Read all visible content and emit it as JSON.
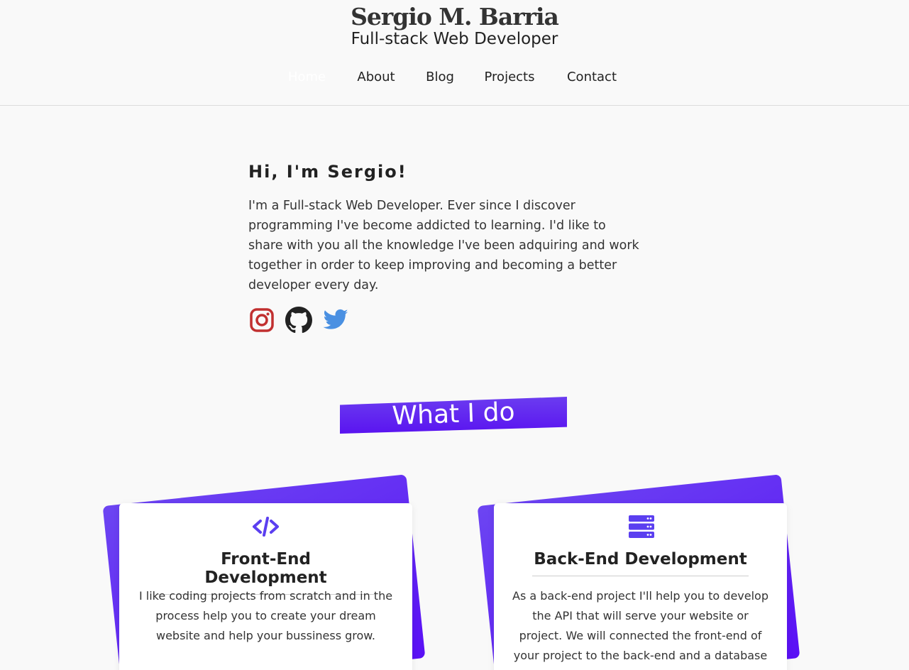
{
  "header": {
    "name": "Sergio M. Barria",
    "tagline": "Full-stack Web Developer"
  },
  "nav": {
    "items": [
      {
        "label": "Home",
        "active": true
      },
      {
        "label": "About",
        "active": false
      },
      {
        "label": "Blog",
        "active": false
      },
      {
        "label": "Projects",
        "active": false
      },
      {
        "label": "Contact",
        "active": false
      }
    ]
  },
  "intro": {
    "heading": "Hi, I'm Sergio!",
    "text": "I'm a Full-stack Web Developer. Ever since I discover programming I've become addicted to learning. I'd like to share with you all the knowledge I've been adquiring and work together in order to keep improving and becoming a better developer every day."
  },
  "social": [
    {
      "icon": "instagram-icon",
      "color": "#c13030"
    },
    {
      "icon": "github-icon",
      "color": "#222222"
    },
    {
      "icon": "twitter-icon",
      "color": "#4a90e2"
    }
  ],
  "what_i_do": {
    "title": "What I do",
    "cards": [
      {
        "icon": "code-icon",
        "title": "Front-End Development",
        "text": "I like coding projects from scratch and in the process help you to create your dream website and help your bussiness grow."
      },
      {
        "icon": "server-icon",
        "title": "Back-End Development",
        "text": "As a back-end project I'll help you to develop the API that will serve your website or project. We will connected the front-end of your project to the back-end and a database"
      }
    ]
  },
  "colors": {
    "accent": "#5a1ff7",
    "background": "#f9f9f9"
  }
}
